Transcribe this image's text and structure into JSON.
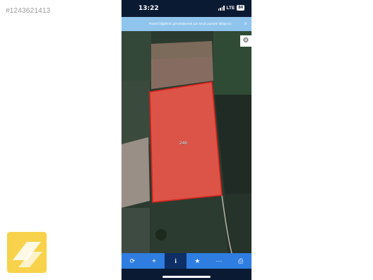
{
  "listing": {
    "id": "#1243621413"
  },
  "status_bar": {
    "time": "13:22",
    "network": "LTE",
    "battery": "84"
  },
  "banner": {
    "text": "Parsel bilgilerini görüntülemek için seçili parsele tıklayınız.",
    "close": "×"
  },
  "map": {
    "parcel_number": "248",
    "parcel_color": "#f0584a"
  },
  "toolbar": {
    "items": [
      {
        "icon": "refresh-icon",
        "glyph": "⟳"
      },
      {
        "icon": "location-icon",
        "glyph": "⌖"
      },
      {
        "icon": "info-icon",
        "glyph": "i"
      },
      {
        "icon": "star-icon",
        "glyph": "★"
      },
      {
        "icon": "measure-icon",
        "glyph": "⋯"
      },
      {
        "icon": "print-icon",
        "glyph": "⎙"
      }
    ]
  },
  "colors": {
    "accent": "#2f7de0",
    "active": "#0d2f66",
    "banner": "#8fc4ec",
    "status": "#0b1a33"
  }
}
